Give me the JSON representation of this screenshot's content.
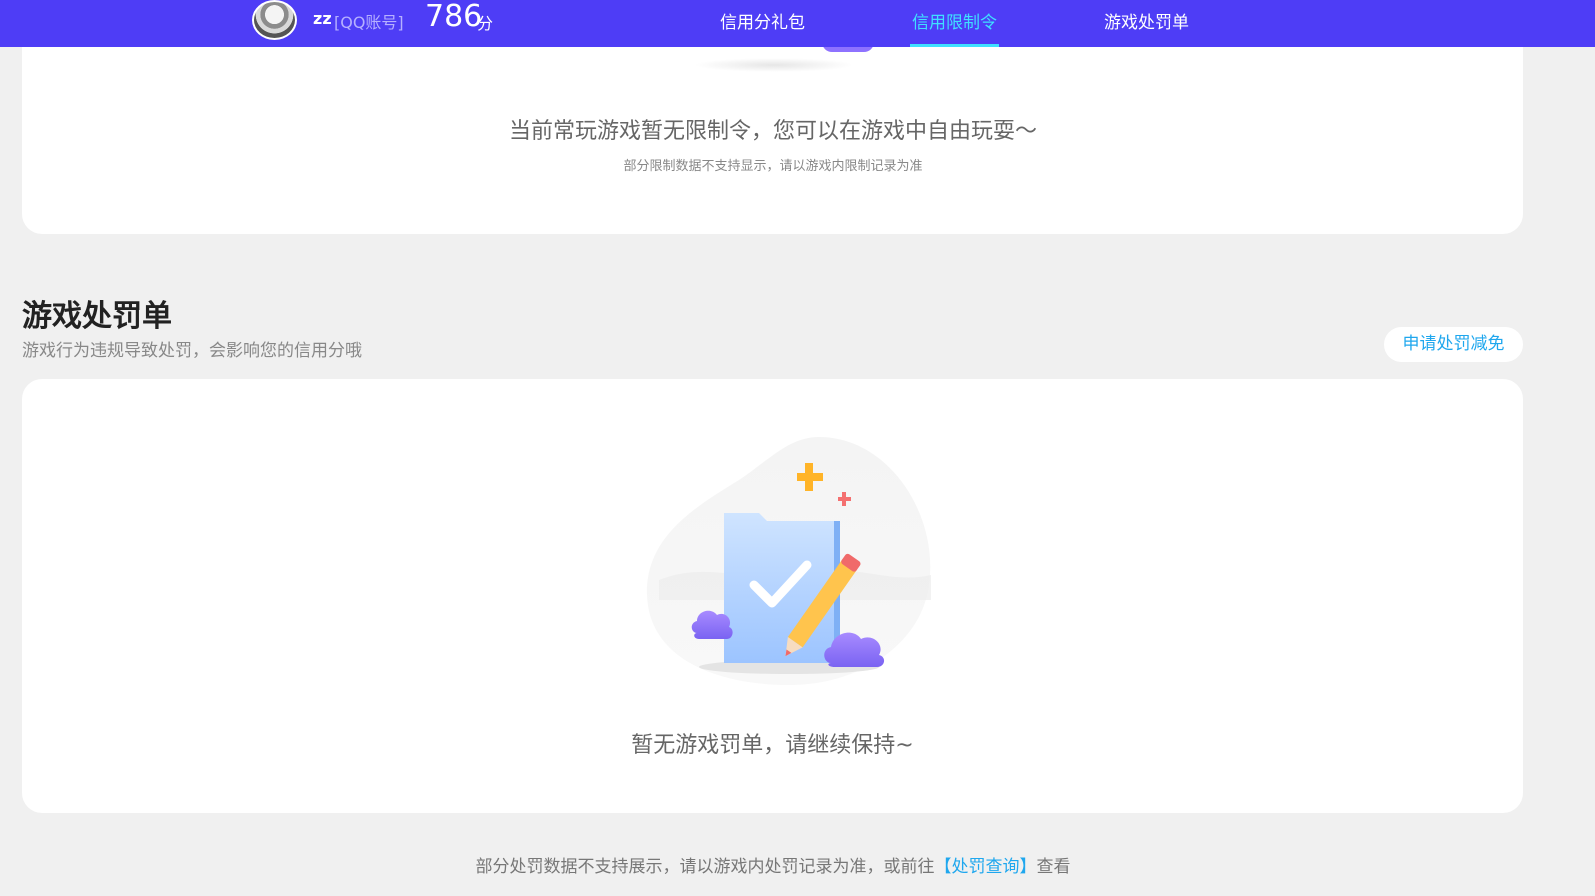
{
  "header": {
    "user_name": "zz",
    "account_type": "[QQ账号]",
    "score_value": "786",
    "score_unit": "分",
    "nav": [
      {
        "label": "信用分礼包"
      },
      {
        "label": "信用限制令"
      },
      {
        "label": "游戏处罚单"
      }
    ],
    "active_tab": "信用限制令"
  },
  "limit_card": {
    "main_text": "当前常玩游戏暂无限制令，您可以在游戏中自由玩耍～",
    "sub_text": "部分限制数据不支持显示，请以游戏内限制记录为准"
  },
  "penalty_section": {
    "title": "游戏处罚单",
    "description": "游戏行为违规导致处罚，会影响您的信用分哦",
    "appeal_label": "申请处罚减免",
    "empty_text": "暂无游戏罚单，请继续保持~"
  },
  "footer": {
    "note_prefix": "部分处罚数据不支持展示，请以游戏内处罚记录为准，或前往",
    "link_text": "【处罚查询】",
    "note_suffix": "查看"
  },
  "colors": {
    "header_bg": "#4e3df6",
    "active_tab": "#3fe0ff",
    "link": "#1fa7ee"
  }
}
